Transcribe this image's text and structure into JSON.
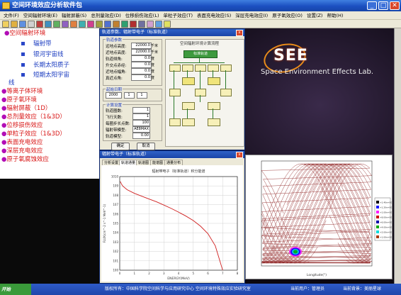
{
  "app": {
    "title": "空间环境效应分析软件包"
  },
  "menu": [
    "文件(F)",
    "空间辐射环境(E)",
    "辐射屏蔽(S)",
    "总剂量效应(D)",
    "位移损伤效应(L)",
    "单粒子效应(T)",
    "表面充电效应(S)",
    "深层充电效应(I)",
    "原子氧效应(O)",
    "设置(Z)",
    "帮助(H)"
  ],
  "nav": {
    "items": [
      {
        "label": "空间辐射环境",
        "level": 0
      },
      {
        "label": "辐射带",
        "level": 1
      },
      {
        "label": "银河宇宙线",
        "level": 1
      },
      {
        "label": "长期太阳质子",
        "level": 1
      },
      {
        "label": "短期太阳宇宙",
        "level": 1
      },
      {
        "label": "线",
        "level": 2
      },
      {
        "label": "等离子体环境",
        "level": 0
      },
      {
        "label": "原子氧环境",
        "level": 0
      },
      {
        "label": "辐射屏蔽（1D）",
        "level": 0
      },
      {
        "label": "总剂量效应（1&3D）",
        "level": 0
      },
      {
        "label": "位移损伤效应",
        "level": 0
      },
      {
        "label": "单粒子效应（1&3D）",
        "level": 0
      },
      {
        "label": "表面充电效应",
        "level": 0
      },
      {
        "label": "深层充电效应",
        "level": 0
      },
      {
        "label": "原子氧腐蚀效应",
        "level": 0
      }
    ]
  },
  "logo": {
    "abbr": "SEE",
    "subtitle": "Space Environment Effects Lab."
  },
  "orbit_dialog": {
    "title": "轨道参数、辐射带电子（标准轨道）",
    "group_orbit": "轨道参数",
    "fields": [
      {
        "label": "远地点高度:",
        "value": "22000.0",
        "unit": "千米"
      },
      {
        "label": "近地点高度:",
        "value": "22000.0",
        "unit": "千米"
      },
      {
        "label": "轨道倾角:",
        "value": "0.0",
        "unit": "度"
      },
      {
        "label": "升交点赤经:",
        "value": "0.0",
        "unit": "度"
      },
      {
        "label": "近地点幅角:",
        "value": "0.0",
        "unit": "度"
      },
      {
        "label": "真近点角:",
        "value": "0.0",
        "unit": "度"
      }
    ],
    "group_start": "起始日期",
    "start_date": [
      "2000",
      "1",
      "1"
    ],
    "group_calc": "计算设置",
    "calc_fields": [
      {
        "label": "轨道圈数:",
        "value": "1"
      },
      {
        "label": "飞行天数:",
        "value": "1"
      },
      {
        "label": "每圈步长点数:",
        "value": "100"
      },
      {
        "label": "辐射带模型:",
        "value": "AE8MAX"
      },
      {
        "label": "轨道模型:",
        "value": "0.00"
      }
    ],
    "flow_title": "空间辐射环境计算流程",
    "flow_start": "标准轨道",
    "ok_label": "确定",
    "cancel_label": "取消"
  },
  "spectrum_window": {
    "title": "辐射带电子（标准轨道）",
    "tabs": [
      "分析设置",
      "轨道通量",
      "轨道图",
      "能谱图",
      "通量分布"
    ],
    "active_tab": 1
  },
  "chart_data": [
    {
      "type": "line",
      "title": "辐射带电子（标准轨道）积分能谱",
      "xlabel": "ENERGY(MeV)",
      "ylabel": "FLUX(cm^-2 s^-1 MeV^-1)",
      "x": [
        0.04,
        0.1,
        0.2,
        0.5,
        1.0,
        1.5,
        2.0,
        2.5,
        3.0,
        3.5,
        4.0,
        4.5,
        5.0,
        5.5,
        6.0,
        6.5,
        7.0
      ],
      "y": [
        3000000000.0,
        1800000000.0,
        1000000000.0,
        400000000.0,
        160000000.0,
        80000000.0,
        40000000.0,
        20000000.0,
        9000000.0,
        4000000.0,
        1600000.0,
        600000.0,
        200000.0,
        50000.0,
        8000.0,
        400.0,
        1
      ],
      "xlim": [
        0,
        8
      ],
      "ylim": [
        1,
        10000000000
      ],
      "yscale": "log",
      "grid": true
    },
    {
      "type": "scatter",
      "title": "",
      "xlabel": "Longitude(°)",
      "ylabel": "",
      "xlim": [
        -180,
        180
      ],
      "ylim": [
        -90,
        90
      ],
      "legend_position": "right",
      "legend": [
        "+1.40e+007",
        "+1.20e+007",
        "+1.00e+007",
        "+8.00e+006",
        "+6.00e+006",
        "+4.00e+006",
        "+2.00e+006",
        "+1.00e+004"
      ]
    }
  ],
  "colors": {
    "legend_swatches": [
      "#000000",
      "#1a1aff",
      "#ff1aff",
      "#cc0000",
      "#0000aa",
      "#00aa00",
      "#00dddd",
      "#aa3a10"
    ],
    "trace": "#8a1a1a"
  },
  "taskbar": {
    "start": "开始",
    "copyright": "版权所有：中国科学院空间科学与应用研究中心 空间环境特殊效应实验研究室",
    "user": "当前用户：管理员",
    "status": "当前背景：美丽星球"
  }
}
